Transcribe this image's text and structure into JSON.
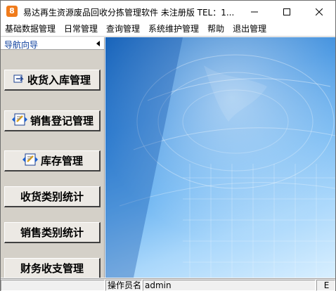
{
  "window": {
    "icon_glyph": "8",
    "title": "易达再生资源废品回收分拣管理软件  未注册版   TEL：1..."
  },
  "menu": [
    {
      "label": "基础数据管理"
    },
    {
      "label": "日常管理"
    },
    {
      "label": "查询管理"
    },
    {
      "label": "系统维护管理"
    },
    {
      "label": "帮助"
    },
    {
      "label": "退出管理"
    }
  ],
  "nav": {
    "header": "导航向导",
    "buttons": [
      {
        "label": "收货入库管理",
        "icon": "receive-icon"
      },
      {
        "label": "销售登记管理",
        "icon": "sales-register-icon"
      },
      {
        "label": "库存管理",
        "icon": "inventory-icon"
      },
      {
        "label": "收货类别统计",
        "icon": ""
      },
      {
        "label": "销售类别统计",
        "icon": ""
      },
      {
        "label": "财务收支管理",
        "icon": ""
      }
    ]
  },
  "status": {
    "operator_label": "操作员名",
    "operator_value": "admin",
    "trailing": "E"
  },
  "colors": {
    "accent_blue": "#1e6fc4",
    "panel_gray": "#d4d0c8",
    "app_icon": "#f07b1b"
  }
}
